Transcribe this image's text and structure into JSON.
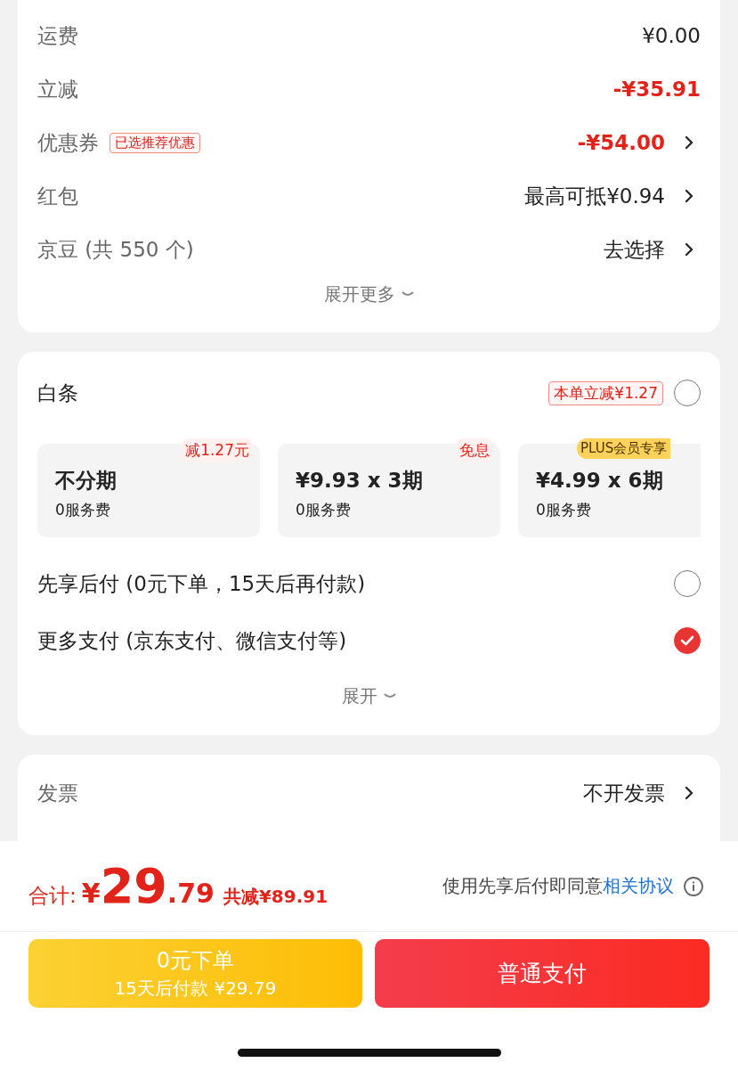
{
  "price_rows": [
    {
      "label": "运费",
      "value": "¥0.00",
      "kind": "plain",
      "arrow": false
    },
    {
      "label": "立减",
      "value": "-¥35.91",
      "kind": "discount",
      "arrow": false
    },
    {
      "label": "优惠券",
      "badge": "已选推荐优惠",
      "value": "-¥54.00",
      "kind": "discount",
      "arrow": true
    },
    {
      "label": "红包",
      "value": "最高可抵¥0.94",
      "kind": "plain",
      "arrow": true
    },
    {
      "label": "京豆 (共 550 个)",
      "value": "去选择",
      "kind": "plain",
      "arrow": true
    }
  ],
  "price_expand": "展开更多",
  "baitiao": {
    "label": "白条",
    "badge": "本单立减¥1.27",
    "checked": false,
    "plans": [
      {
        "title": "不分期",
        "fee": "0服务费",
        "tag": "减1.27元",
        "kind": "offer"
      },
      {
        "title": "¥9.93 x 3期",
        "fee": "0服务费",
        "tag": "免息",
        "kind": "offer"
      },
      {
        "title": "¥4.99 x 6期",
        "fee": "0服务费",
        "tag": "PLUS会员专享",
        "kind": "member"
      }
    ]
  },
  "pay_options": [
    {
      "label": "先享后付 (0元下单，15天后再付款)",
      "checked": false
    },
    {
      "label": "更多支付 (京东支付、微信支付等)",
      "checked": true
    }
  ],
  "pay_expand": "展开",
  "invoice": {
    "label": "发票",
    "value": "不开发票"
  },
  "footer": {
    "total_label": "合计:",
    "currency": "¥",
    "integer": "29",
    "decimal": ".79",
    "savings": "共减¥89.91",
    "agreement": "使用先享后付即同意",
    "agreement_link": "相关协议",
    "buttons": [
      {
        "kind": "later",
        "title": "0元下单",
        "subtitle": "15天后付款 ¥29.79"
      },
      {
        "kind": "pay",
        "title": "普通支付"
      }
    ]
  }
}
